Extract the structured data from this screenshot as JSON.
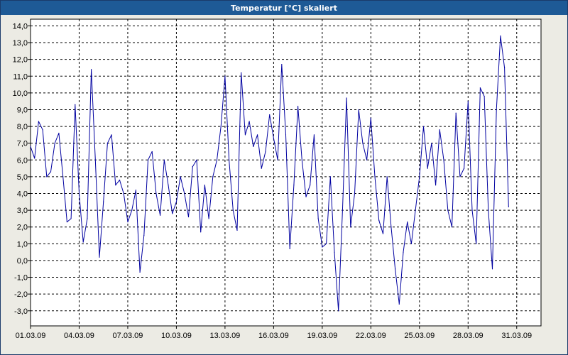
{
  "window": {
    "title": "Temperatur [°C] skaliert"
  },
  "chart_data": {
    "type": "line",
    "title": "Temperatur [°C] skaliert",
    "xlabel": "",
    "ylabel": "",
    "ylim": [
      -3.9,
      14.4
    ],
    "xlim": [
      "2009-03-01T00:00",
      "2009-04-01T12:00"
    ],
    "grid": true,
    "y_ticks": [
      "14,0",
      "13,0",
      "12,0",
      "11,0",
      "10,0",
      "9,0",
      "8,0",
      "7,0",
      "6,0",
      "5,0",
      "4,0",
      "3,0",
      "2,0",
      "1,0",
      "0,0",
      "-1,0",
      "-2,0",
      "-3,0"
    ],
    "x_ticks": [
      "01.03.09",
      "04.03.09",
      "07.03.09",
      "10.03.09",
      "13.03.09",
      "16.03.09",
      "19.03.09",
      "22.03.09",
      "25.03.09",
      "28.03.09",
      "31.03.09"
    ],
    "series": [
      {
        "color": "#0000a0",
        "points": [
          [
            "2009-03-01T00:00",
            6.8
          ],
          [
            "2009-03-01T06:00",
            6.1
          ],
          [
            "2009-03-01T12:00",
            8.3
          ],
          [
            "2009-03-01T18:00",
            7.8
          ],
          [
            "2009-03-02T00:00",
            5.0
          ],
          [
            "2009-03-02T06:00",
            5.3
          ],
          [
            "2009-03-02T12:00",
            7.0
          ],
          [
            "2009-03-02T18:00",
            7.6
          ],
          [
            "2009-03-03T00:00",
            5.0
          ],
          [
            "2009-03-03T06:00",
            2.3
          ],
          [
            "2009-03-03T12:00",
            2.5
          ],
          [
            "2009-03-03T18:00",
            9.3
          ],
          [
            "2009-03-04T00:00",
            4.0
          ],
          [
            "2009-03-04T06:00",
            1.1
          ],
          [
            "2009-03-04T12:00",
            2.5
          ],
          [
            "2009-03-04T18:00",
            11.4
          ],
          [
            "2009-03-05T00:00",
            6.0
          ],
          [
            "2009-03-05T06:00",
            0.2
          ],
          [
            "2009-03-05T12:00",
            3.5
          ],
          [
            "2009-03-05T18:00",
            7.0
          ],
          [
            "2009-03-06T00:00",
            7.5
          ],
          [
            "2009-03-06T06:00",
            4.5
          ],
          [
            "2009-03-06T12:00",
            4.8
          ],
          [
            "2009-03-06T18:00",
            4.0
          ],
          [
            "2009-03-07T00:00",
            2.3
          ],
          [
            "2009-03-07T06:00",
            3.0
          ],
          [
            "2009-03-07T12:00",
            4.2
          ],
          [
            "2009-03-07T18:00",
            -0.7
          ],
          [
            "2009-03-08T00:00",
            1.5
          ],
          [
            "2009-03-08T06:00",
            6.0
          ],
          [
            "2009-03-08T12:00",
            6.5
          ],
          [
            "2009-03-08T18:00",
            4.0
          ],
          [
            "2009-03-09T00:00",
            2.7
          ],
          [
            "2009-03-09T06:00",
            6.0
          ],
          [
            "2009-03-09T12:00",
            4.5
          ],
          [
            "2009-03-09T18:00",
            2.8
          ],
          [
            "2009-03-10T00:00",
            3.5
          ],
          [
            "2009-03-10T06:00",
            5.0
          ],
          [
            "2009-03-10T12:00",
            4.0
          ],
          [
            "2009-03-10T18:00",
            2.6
          ],
          [
            "2009-03-11T00:00",
            5.6
          ],
          [
            "2009-03-11T06:00",
            6.0
          ],
          [
            "2009-03-11T12:00",
            1.7
          ],
          [
            "2009-03-11T18:00",
            4.5
          ],
          [
            "2009-03-12T00:00",
            2.5
          ],
          [
            "2009-03-12T06:00",
            5.0
          ],
          [
            "2009-03-12T12:00",
            6.0
          ],
          [
            "2009-03-12T18:00",
            8.0
          ],
          [
            "2009-03-13T00:00",
            11.0
          ],
          [
            "2009-03-13T06:00",
            6.0
          ],
          [
            "2009-03-13T12:00",
            3.0
          ],
          [
            "2009-03-13T18:00",
            1.8
          ],
          [
            "2009-03-14T00:00",
            11.2
          ],
          [
            "2009-03-14T06:00",
            7.5
          ],
          [
            "2009-03-14T12:00",
            8.3
          ],
          [
            "2009-03-14T18:00",
            6.8
          ],
          [
            "2009-03-15T00:00",
            7.5
          ],
          [
            "2009-03-15T06:00",
            5.5
          ],
          [
            "2009-03-15T12:00",
            6.5
          ],
          [
            "2009-03-15T18:00",
            8.7
          ],
          [
            "2009-03-16T00:00",
            7.3
          ],
          [
            "2009-03-16T06:00",
            6.0
          ],
          [
            "2009-03-16T12:00",
            11.7
          ],
          [
            "2009-03-16T18:00",
            7.5
          ],
          [
            "2009-03-17T00:00",
            0.7
          ],
          [
            "2009-03-17T06:00",
            4.5
          ],
          [
            "2009-03-17T12:00",
            9.2
          ],
          [
            "2009-03-17T18:00",
            6.0
          ],
          [
            "2009-03-18T00:00",
            3.8
          ],
          [
            "2009-03-18T06:00",
            4.5
          ],
          [
            "2009-03-18T12:00",
            7.5
          ],
          [
            "2009-03-18T18:00",
            2.5
          ],
          [
            "2009-03-19T00:00",
            0.8
          ],
          [
            "2009-03-19T06:00",
            1.0
          ],
          [
            "2009-03-19T12:00",
            5.0
          ],
          [
            "2009-03-19T18:00",
            0.5
          ],
          [
            "2009-03-20T00:00",
            -3.0
          ],
          [
            "2009-03-20T06:00",
            3.0
          ],
          [
            "2009-03-20T12:00",
            9.7
          ],
          [
            "2009-03-20T18:00",
            2.0
          ],
          [
            "2009-03-21T00:00",
            4.0
          ],
          [
            "2009-03-21T06:00",
            9.0
          ],
          [
            "2009-03-21T12:00",
            7.0
          ],
          [
            "2009-03-21T18:00",
            6.0
          ],
          [
            "2009-03-22T00:00",
            8.5
          ],
          [
            "2009-03-22T06:00",
            5.0
          ],
          [
            "2009-03-22T12:00",
            2.4
          ],
          [
            "2009-03-22T18:00",
            1.6
          ],
          [
            "2009-03-23T00:00",
            5.0
          ],
          [
            "2009-03-23T06:00",
            2.0
          ],
          [
            "2009-03-23T12:00",
            -0.5
          ],
          [
            "2009-03-23T18:00",
            -2.6
          ],
          [
            "2009-03-24T00:00",
            0.5
          ],
          [
            "2009-03-24T06:00",
            2.3
          ],
          [
            "2009-03-24T12:00",
            1.0
          ],
          [
            "2009-03-24T18:00",
            3.0
          ],
          [
            "2009-03-25T00:00",
            5.0
          ],
          [
            "2009-03-25T06:00",
            8.0
          ],
          [
            "2009-03-25T12:00",
            5.5
          ],
          [
            "2009-03-25T18:00",
            7.0
          ],
          [
            "2009-03-26T00:00",
            4.5
          ],
          [
            "2009-03-26T06:00",
            7.8
          ],
          [
            "2009-03-26T12:00",
            6.0
          ],
          [
            "2009-03-26T18:00",
            3.0
          ],
          [
            "2009-03-27T00:00",
            2.0
          ],
          [
            "2009-03-27T06:00",
            8.8
          ],
          [
            "2009-03-27T12:00",
            5.0
          ],
          [
            "2009-03-27T18:00",
            5.5
          ],
          [
            "2009-03-28T00:00",
            9.5
          ],
          [
            "2009-03-28T06:00",
            3.0
          ],
          [
            "2009-03-28T12:00",
            1.0
          ],
          [
            "2009-03-28T18:00",
            10.3
          ],
          [
            "2009-03-29T00:00",
            9.8
          ],
          [
            "2009-03-29T06:00",
            3.0
          ],
          [
            "2009-03-29T12:00",
            -0.5
          ],
          [
            "2009-03-29T18:00",
            9.0
          ],
          [
            "2009-03-30T00:00",
            13.4
          ],
          [
            "2009-03-30T06:00",
            11.5
          ],
          [
            "2009-03-30T12:00",
            3.2
          ]
        ]
      }
    ]
  }
}
